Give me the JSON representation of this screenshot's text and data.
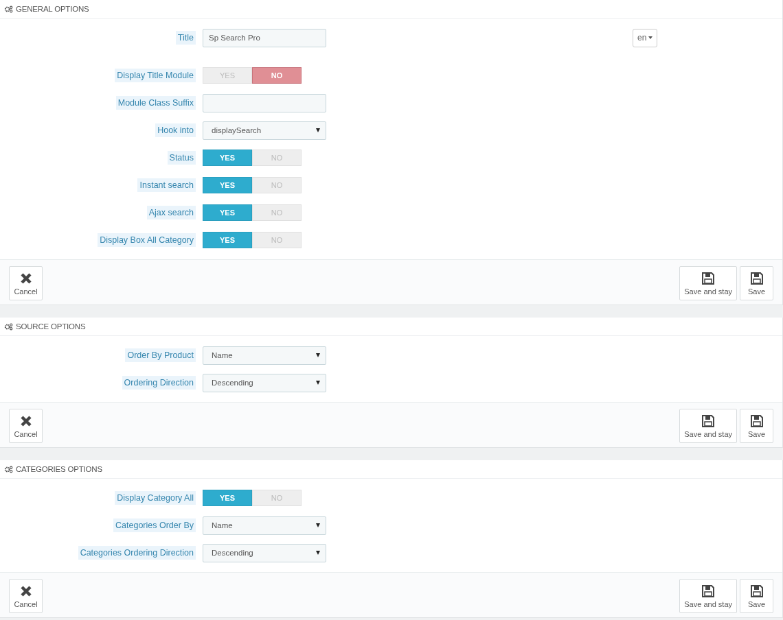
{
  "panels": [
    {
      "title": "GENERAL OPTIONS",
      "fields": [
        {
          "kind": "text",
          "label": "Title",
          "value": "Sp Search Pro",
          "language": "en"
        },
        {
          "kind": "switch",
          "label": "Display Title Module",
          "options": [
            {
              "label": "YES",
              "selected": false
            },
            {
              "label": "NO",
              "selected": true
            }
          ]
        },
        {
          "kind": "text",
          "label": "Module Class Suffix"
        },
        {
          "kind": "select",
          "label": "Hook into",
          "value": "displaySearch"
        },
        {
          "kind": "switch",
          "label": "Status",
          "options": [
            {
              "label": "YES",
              "selected": true
            },
            {
              "label": "NO",
              "selected": false
            }
          ]
        },
        {
          "kind": "switch",
          "label": "Instant search",
          "options": [
            {
              "label": "YES",
              "selected": true
            },
            {
              "label": "NO",
              "selected": false
            }
          ]
        },
        {
          "kind": "switch",
          "label": "Ajax search",
          "options": [
            {
              "label": "YES",
              "selected": true
            },
            {
              "label": "NO",
              "selected": false
            }
          ]
        },
        {
          "kind": "switch",
          "label": "Display Box All Category",
          "options": [
            {
              "label": "YES",
              "selected": true
            },
            {
              "label": "NO",
              "selected": false
            }
          ]
        }
      ],
      "buttons": {
        "cancel": "Cancel",
        "save_and_stay": "Save and stay",
        "save": "Save"
      }
    },
    {
      "title": "SOURCE OPTIONS",
      "fields": [
        {
          "kind": "select",
          "label": "Order By Product",
          "value": "Name"
        },
        {
          "kind": "select",
          "label": "Ordering Direction",
          "value": "Descending"
        }
      ],
      "buttons": {
        "cancel": "Cancel",
        "save_and_stay": "Save and stay",
        "save": "Save"
      }
    },
    {
      "title": "CATEGORIES OPTIONS",
      "fields": [
        {
          "kind": "switch",
          "label": "Display Category All",
          "options": [
            {
              "label": "YES",
              "selected": true
            },
            {
              "label": "NO",
              "selected": false
            }
          ]
        },
        {
          "kind": "select",
          "label": "Categories Order By",
          "value": "Name"
        },
        {
          "kind": "select",
          "label": "Categories Ordering Direction",
          "value": "Descending"
        }
      ],
      "buttons": {
        "cancel": "Cancel",
        "save_and_stay": "Save and stay",
        "save": "Save"
      }
    }
  ]
}
